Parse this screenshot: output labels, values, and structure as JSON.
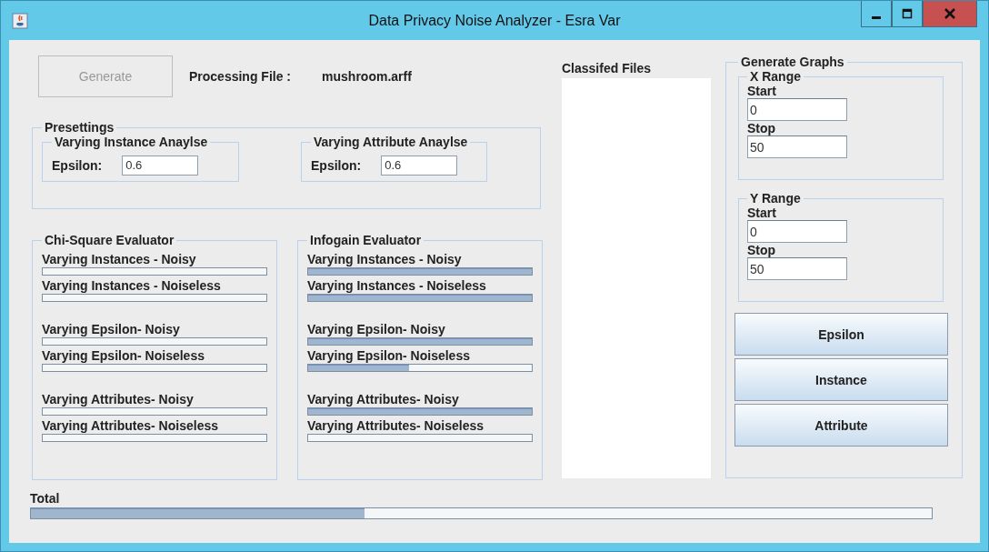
{
  "window": {
    "title": "Data Privacy Noise Analyzer - Esra Var"
  },
  "generate_button": {
    "label": "Generate",
    "disabled": true
  },
  "processing_file": {
    "label": "Processing File :",
    "value": "mushroom.arff"
  },
  "presettings": {
    "title": "Presettings",
    "groups": [
      {
        "title": "Varying Instance Anaylse",
        "epsilon_label": "Epsilon:",
        "epsilon_value": "0.6"
      },
      {
        "title": "Varying Attribute Anaylse",
        "epsilon_label": "Epsilon:",
        "epsilon_value": "0.6"
      }
    ]
  },
  "evaluators": [
    {
      "title": "Chi-Square Evaluator",
      "sections": [
        {
          "bars": [
            {
              "label": "Varying Instances - Noisy",
              "level": 0
            },
            {
              "label": "Varying Instances - Noiseless",
              "level": 0
            }
          ]
        },
        {
          "bars": [
            {
              "label": "Varying Epsilon- Noisy",
              "level": 0
            },
            {
              "label": "Varying Epsilon- Noiseless",
              "level": 0
            }
          ]
        },
        {
          "bars": [
            {
              "label": "Varying Attributes- Noisy",
              "level": 0
            },
            {
              "label": "Varying Attributes- Noiseless",
              "level": 0
            }
          ]
        }
      ]
    },
    {
      "title": "Infogain Evaluator",
      "sections": [
        {
          "bars": [
            {
              "label": "Varying Instances - Noisy",
              "level": 1
            },
            {
              "label": "Varying Instances - Noiseless",
              "level": 1
            }
          ]
        },
        {
          "bars": [
            {
              "label": "Varying Epsilon- Noisy",
              "level": 1
            },
            {
              "label": "Varying Epsilon- Noiseless",
              "level": 0.45
            }
          ]
        },
        {
          "bars": [
            {
              "label": "Varying Attributes- Noisy",
              "level": 1
            },
            {
              "label": "Varying Attributes- Noiseless",
              "level": 0
            }
          ]
        }
      ]
    }
  ],
  "classified_files": {
    "title": "Classifed Files"
  },
  "generate_graphs": {
    "title": "Generate Graphs",
    "ranges": [
      {
        "title": "X Range",
        "start_label": "Start",
        "start_value": "0",
        "stop_label": "Stop",
        "stop_value": "50"
      },
      {
        "title": "Y Range",
        "start_label": "Start",
        "start_value": "0",
        "stop_label": "Stop",
        "stop_value": "50"
      }
    ],
    "buttons": [
      "Epsilon",
      "Instance",
      "Attribute"
    ]
  },
  "total": {
    "label": "Total",
    "level": 0.37
  }
}
